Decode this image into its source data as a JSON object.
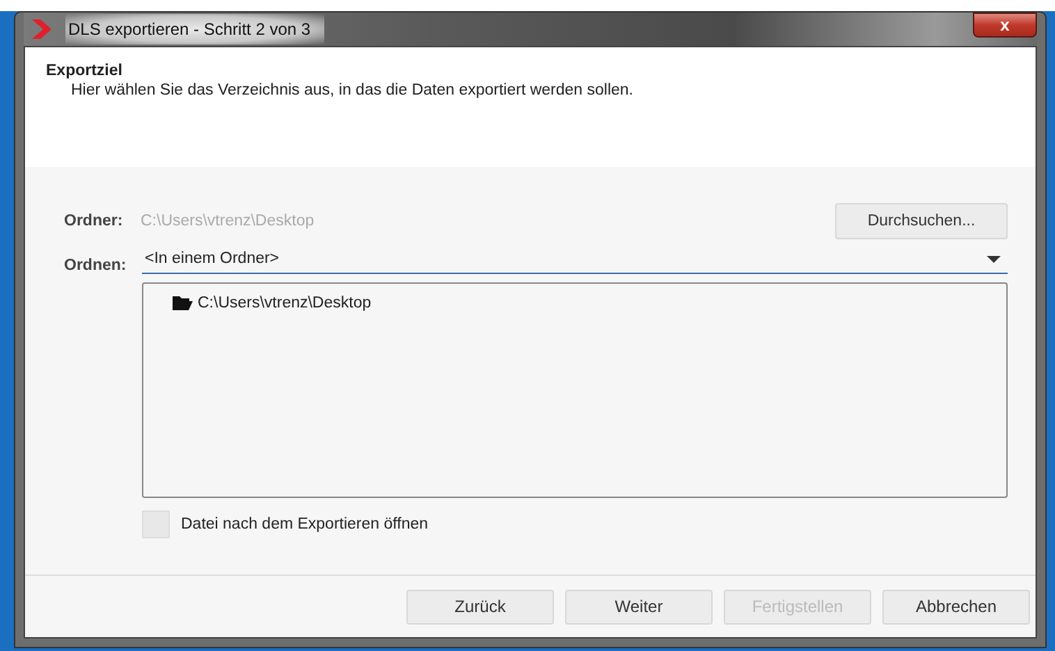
{
  "window": {
    "title": "DLS exportieren - Schritt 2 von 3",
    "close": "x"
  },
  "header": {
    "title": "Exportziel",
    "description": "Hier wählen Sie das Verzeichnis aus, in das die Daten exportiert werden sollen."
  },
  "folder": {
    "label": "Ordner:",
    "value": "C:\\Users\\vtrenz\\Desktop",
    "disabled": true,
    "browse_button": "Durchsuchen..."
  },
  "arrange": {
    "label": "Ordnen:",
    "value": "<In einem Ordner>"
  },
  "tree": [
    {
      "label": "C:\\Users\\vtrenz\\Desktop"
    }
  ],
  "open_after_export": {
    "label": "Datei nach dem Exportieren öffnen",
    "checked": false
  },
  "buttons": [
    {
      "label": "Zurück",
      "disabled": false
    },
    {
      "label": "Weiter",
      "disabled": false
    },
    {
      "label": "Fertigstellen",
      "disabled": true
    },
    {
      "label": "Abbrechen",
      "disabled": false
    }
  ]
}
